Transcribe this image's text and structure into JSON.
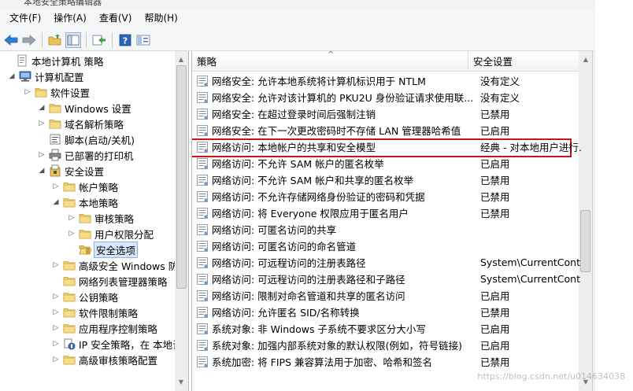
{
  "window": {
    "title": "本地安全策略编辑器"
  },
  "menu": [
    {
      "label": "文件(F)"
    },
    {
      "label": "操作(A)"
    },
    {
      "label": "查看(V)"
    },
    {
      "label": "帮助(H)"
    }
  ],
  "toolbar": {
    "buttons": [
      {
        "icon": "back-arrow-icon"
      },
      {
        "icon": "forward-arrow-icon"
      },
      {
        "icon": "up-folder-icon"
      },
      {
        "icon": "show-tree-icon"
      },
      {
        "icon": "export-list-icon"
      },
      {
        "icon": "help-icon"
      },
      {
        "icon": "properties-icon"
      }
    ]
  },
  "tree": [
    {
      "label": "本地计算机 策略",
      "icon": "policy-doc-icon",
      "expander": "",
      "depth": 0
    },
    {
      "label": "计算机配置",
      "icon": "computer-icon",
      "expander": "◢",
      "depth": 1
    },
    {
      "label": "软件设置",
      "icon": "folder-icon",
      "expander": "▷",
      "depth": 2
    },
    {
      "label": "Windows 设置",
      "icon": "folder-icon",
      "expander": "◢",
      "depth": 2
    },
    {
      "label": "域名解析策略",
      "icon": "folder-icon",
      "expander": "▷",
      "depth": 3
    },
    {
      "label": "脚本(启动/关机)",
      "icon": "script-icon",
      "expander": "",
      "depth": 3
    },
    {
      "label": "已部署的打印机",
      "icon": "printer-icon",
      "expander": "▷",
      "depth": 3
    },
    {
      "label": "安全设置",
      "icon": "security-icon",
      "expander": "◢",
      "depth": 3
    },
    {
      "label": "帐户策略",
      "icon": "folder-icon",
      "expander": "▷",
      "depth": 4
    },
    {
      "label": "本地策略",
      "icon": "folder-icon",
      "expander": "◢",
      "depth": 4
    },
    {
      "label": "审核策略",
      "icon": "folder-icon",
      "expander": "▷",
      "depth": 5
    },
    {
      "label": "用户权限分配",
      "icon": "folder-icon",
      "expander": "▷",
      "depth": 5
    },
    {
      "label": "安全选项",
      "icon": "folder-open-icon",
      "expander": "",
      "depth": 5,
      "selected": true
    },
    {
      "label": "高级安全 Windows 防",
      "icon": "folder-icon",
      "expander": "▷",
      "depth": 4
    },
    {
      "label": "网络列表管理器策略",
      "icon": "folder-icon",
      "expander": "",
      "depth": 4
    },
    {
      "label": "公钥策略",
      "icon": "folder-icon",
      "expander": "▷",
      "depth": 4
    },
    {
      "label": "软件限制策略",
      "icon": "folder-icon",
      "expander": "▷",
      "depth": 4
    },
    {
      "label": "应用程序控制策略",
      "icon": "folder-icon",
      "expander": "▷",
      "depth": 4
    },
    {
      "label": "IP 安全策略，在 本地计",
      "icon": "ip-security-icon",
      "expander": "▷",
      "depth": 4
    },
    {
      "label": "高级审核策略配置",
      "icon": "folder-icon",
      "expander": "▷",
      "depth": 4
    }
  ],
  "list": {
    "columns": [
      "策略",
      "安全设置"
    ],
    "rows": [
      {
        "policy": "网络安全: 允许本地系统将计算机标识用于 NTLM",
        "setting": "没有定义"
      },
      {
        "policy": "网络安全: 允许对该计算机的 PKU2U 身份验证请求使用联...",
        "setting": "没有定义"
      },
      {
        "policy": "网络安全: 在超过登录时间后强制注销",
        "setting": "已禁用"
      },
      {
        "policy": "网络安全: 在下一次更改密码时不存储 LAN 管理器哈希值",
        "setting": "已启用"
      },
      {
        "policy": "网络访问: 本地帐户的共享和安全模型",
        "setting": "经典 - 对本地用户进行...",
        "highlighted": true
      },
      {
        "policy": "网络访问: 不允许 SAM 帐户的匿名枚举",
        "setting": "已启用"
      },
      {
        "policy": "网络访问: 不允许 SAM 帐户和共享的匿名枚举",
        "setting": "已禁用"
      },
      {
        "policy": "网络访问: 不允许存储网络身份验证的密码和凭据",
        "setting": "已禁用"
      },
      {
        "policy": "网络访问: 将 Everyone 权限应用于匿名用户",
        "setting": "已禁用"
      },
      {
        "policy": "网络访问: 可匿名访问的共享",
        "setting": ""
      },
      {
        "policy": "网络访问: 可匿名访问的命名管道",
        "setting": ""
      },
      {
        "policy": "网络访问: 可远程访问的注册表路径",
        "setting": "System\\CurrentContro..."
      },
      {
        "policy": "网络访问: 可远程访问的注册表路径和子路径",
        "setting": "System\\CurrentContro..."
      },
      {
        "policy": "网络访问: 限制对命名管道和共享的匿名访问",
        "setting": "已启用"
      },
      {
        "policy": "网络访问: 允许匿名 SID/名称转换",
        "setting": "已禁用"
      },
      {
        "policy": "系统对象: 非 Windows 子系统不要求区分大小写",
        "setting": "已启用"
      },
      {
        "policy": "系统对象: 加强内部系统对象的默认权限(例如，符号链接)",
        "setting": "已启用"
      },
      {
        "policy": "系统加密: 将 FIPS 兼容算法用于加密、哈希和签名",
        "setting": "已禁用"
      }
    ]
  },
  "watermark": "https://blog.csdn.net/u014634038",
  "colors": {
    "highlight_border": "#c81414",
    "selection_bg": "#d7e8fb"
  }
}
